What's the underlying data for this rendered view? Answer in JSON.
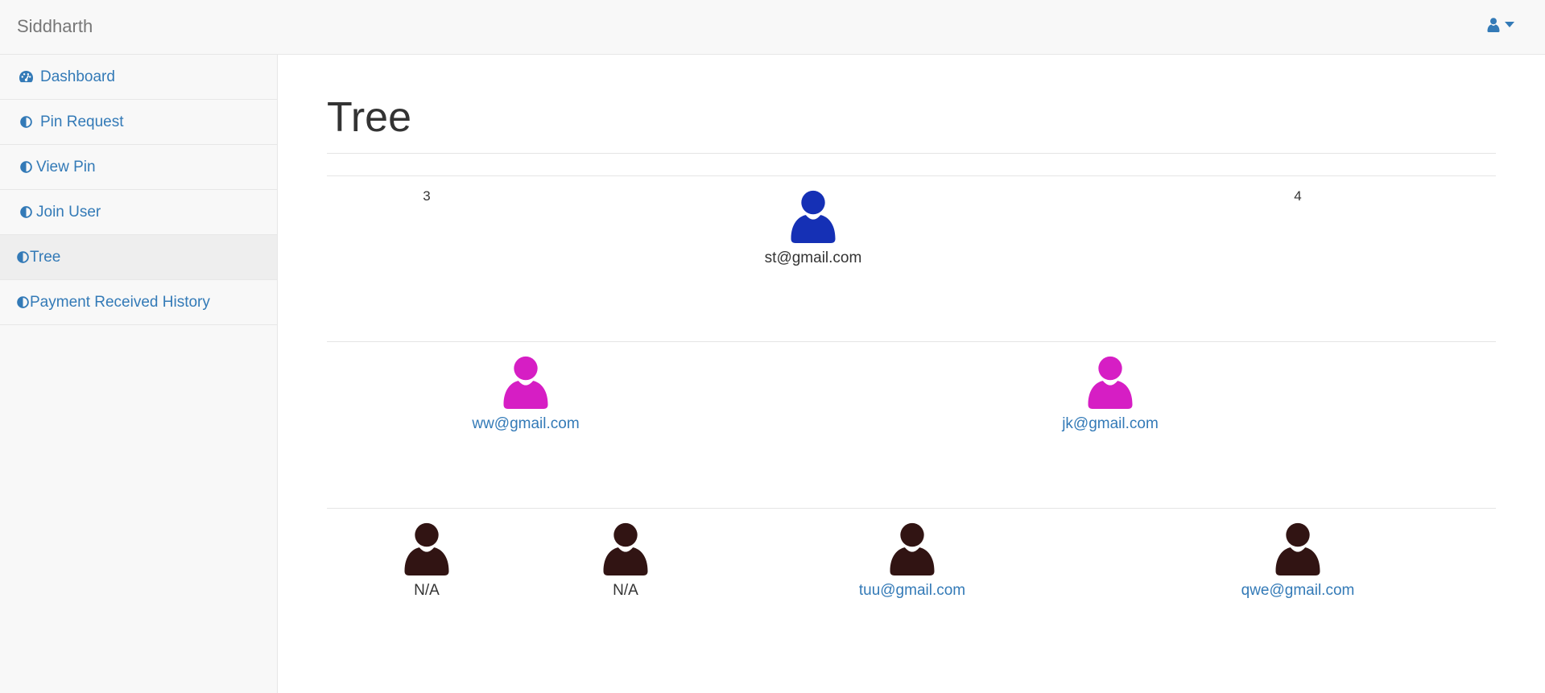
{
  "app": {
    "brand": "Siddharth"
  },
  "colors": {
    "link": "#337ab7",
    "root": "#1530b5",
    "level1": "#d61ec4",
    "level2": "#311413"
  },
  "sidebar": {
    "items": [
      {
        "label": "Dashboard",
        "icon": "dashboard-icon"
      },
      {
        "label": "Pin Request",
        "icon": "half-circle-icon"
      },
      {
        "label": "View Pin",
        "icon": "half-circle-icon"
      },
      {
        "label": "Join User",
        "icon": "half-circle-icon"
      },
      {
        "label": "Tree",
        "icon": "half-circle-icon",
        "active": true
      },
      {
        "label": "Payment Received History",
        "icon": "half-circle-icon"
      }
    ]
  },
  "header": {
    "user_icon": "user-icon",
    "caret_icon": "caret-down-icon"
  },
  "main": {
    "title": "Tree",
    "root": {
      "left_count": "3",
      "right_count": "4",
      "email": "st@gmail.com"
    },
    "level1": [
      {
        "email": "ww@gmail.com"
      },
      {
        "email": "jk@gmail.com"
      }
    ],
    "level2": [
      {
        "email": "N/A"
      },
      {
        "email": "N/A"
      },
      {
        "email": "tuu@gmail.com"
      },
      {
        "email": "qwe@gmail.com"
      }
    ]
  }
}
